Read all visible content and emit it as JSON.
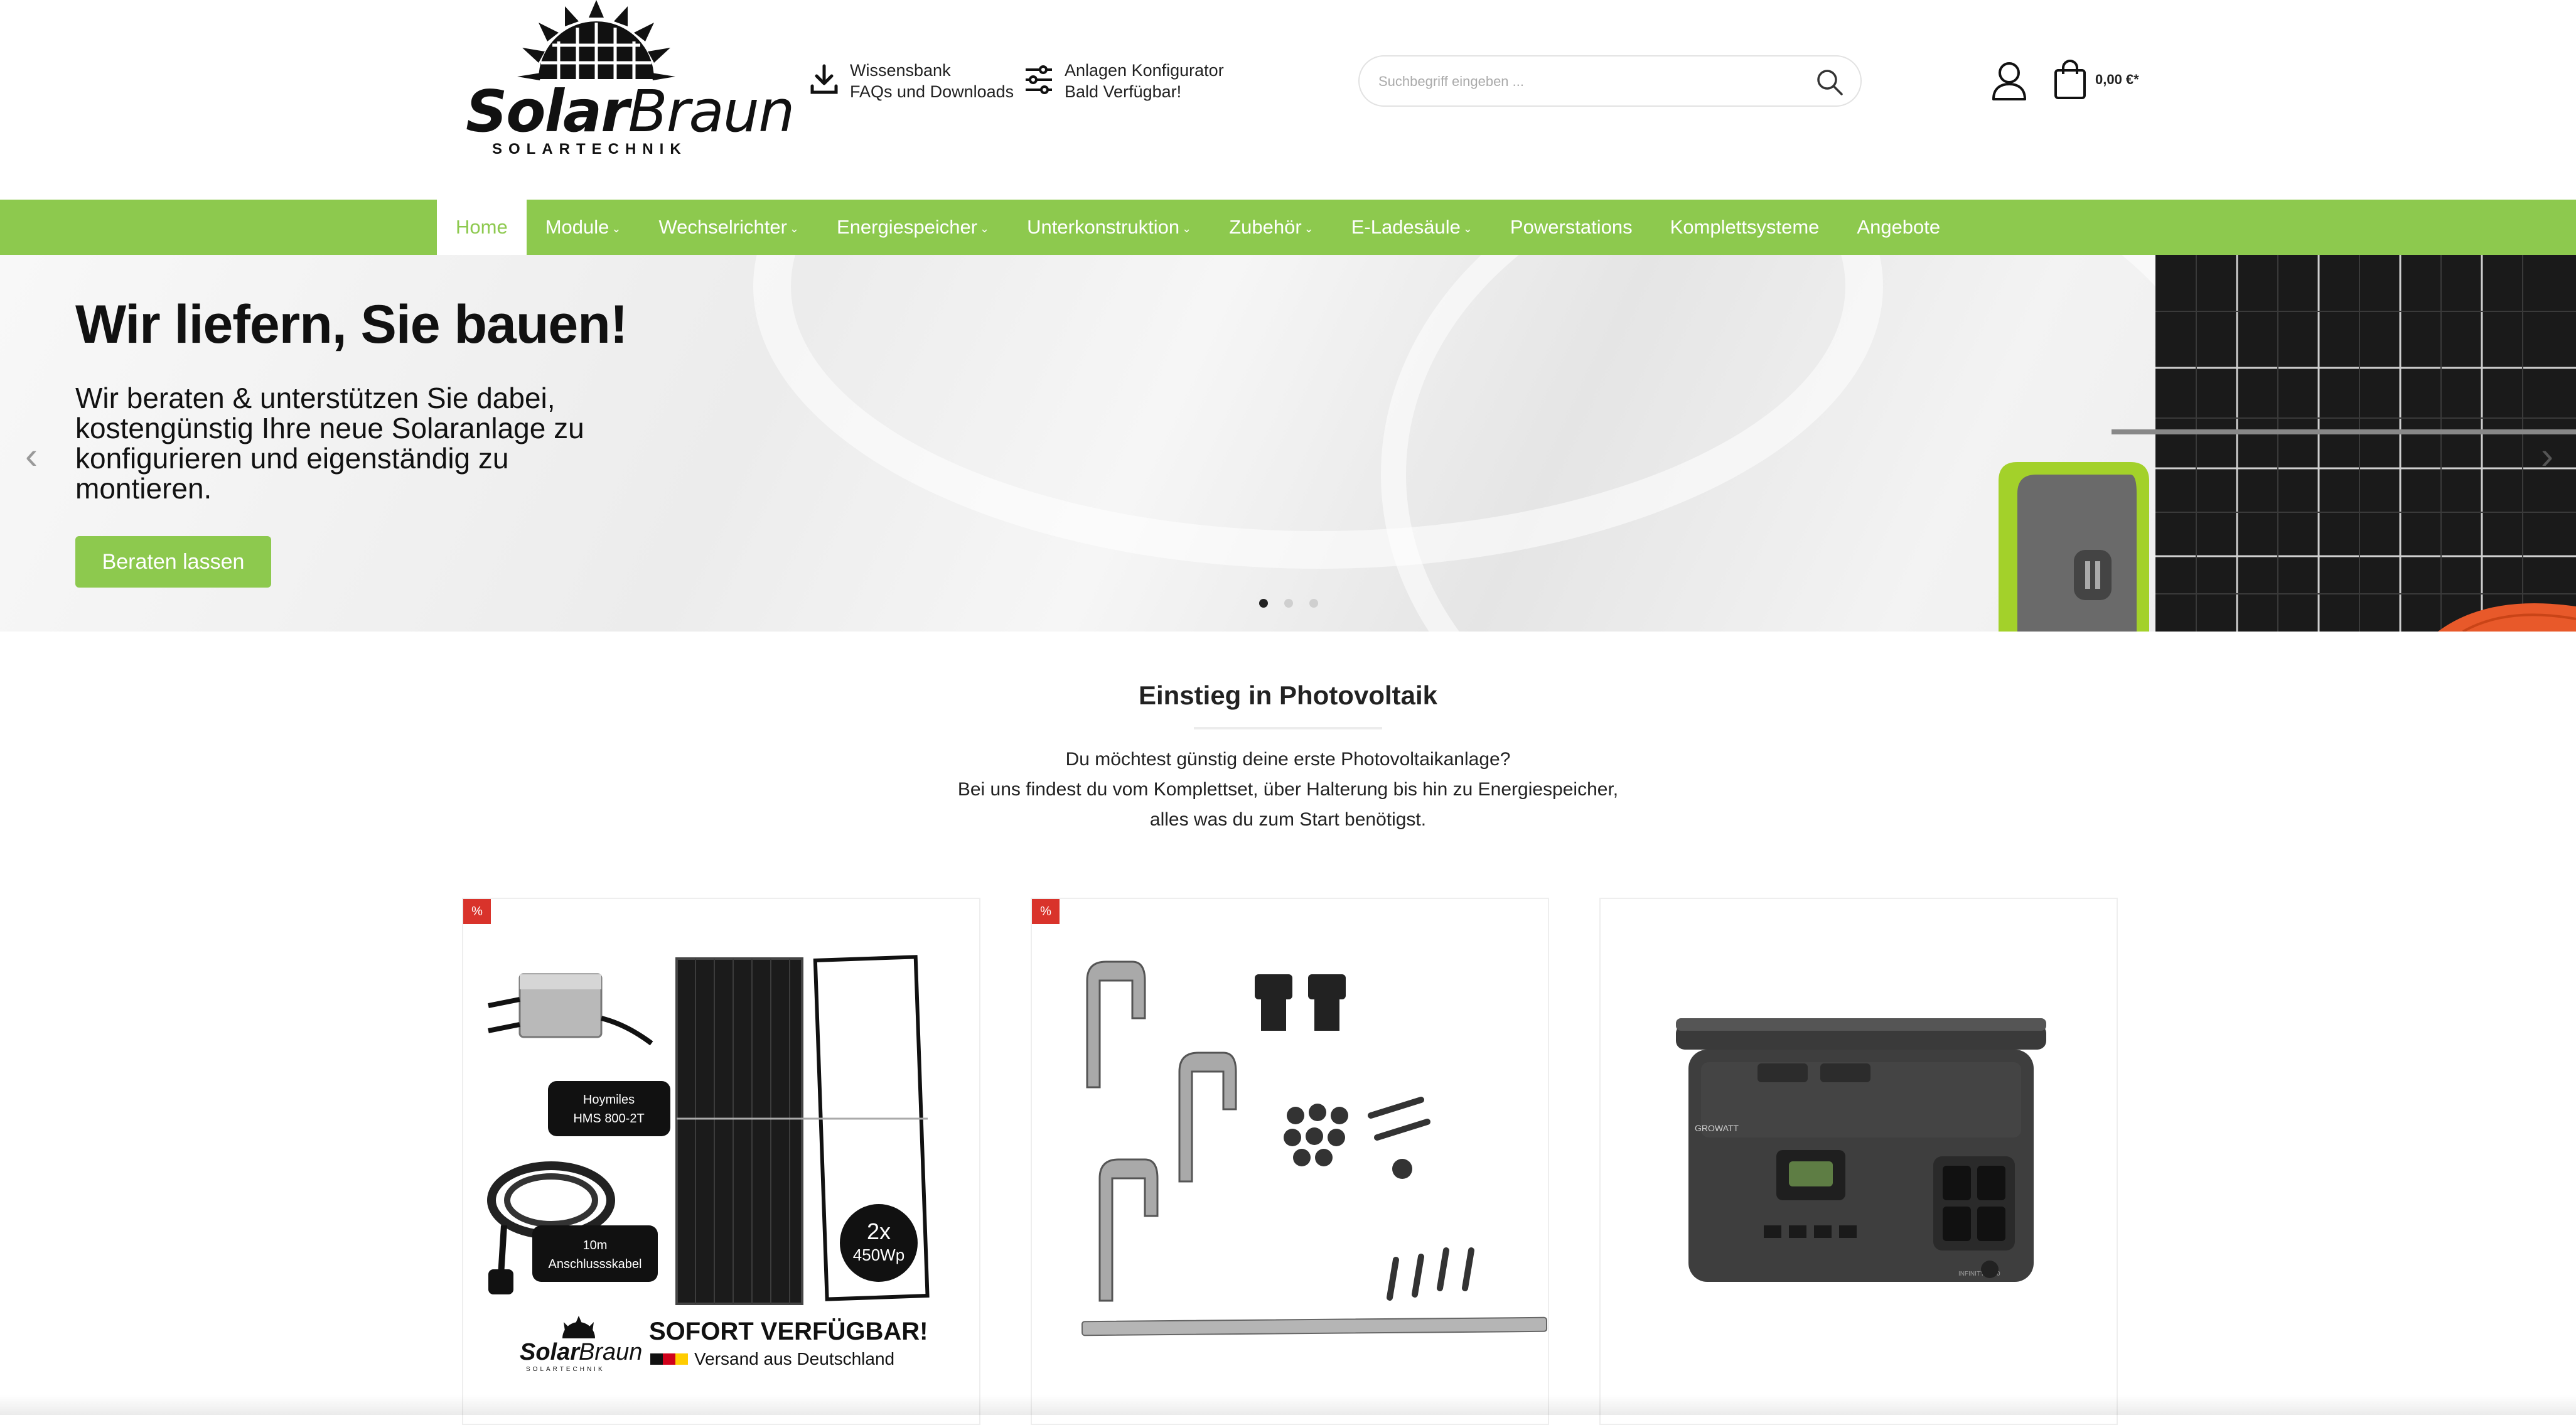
{
  "brand": {
    "name_bold": "Solar",
    "name_thin": "Braun",
    "tagline": "SOLARTECHNIK"
  },
  "header": {
    "links": [
      {
        "line1": "Wissensbank",
        "line2": "FAQs und Downloads",
        "icon": "download-icon"
      },
      {
        "line1": "Anlagen Konfigurator",
        "line2": "Bald Verfügbar!",
        "icon": "sliders-icon"
      }
    ],
    "search_placeholder": "Suchbegriff eingeben ...",
    "cart_amount": "0,00 €*"
  },
  "nav": {
    "items": [
      {
        "label": "Home",
        "has_dropdown": false,
        "active": true
      },
      {
        "label": "Module",
        "has_dropdown": true
      },
      {
        "label": "Wechselrichter",
        "has_dropdown": true
      },
      {
        "label": "Energiespeicher",
        "has_dropdown": true
      },
      {
        "label": "Unterkonstruktion",
        "has_dropdown": true
      },
      {
        "label": "Zubehör",
        "has_dropdown": true
      },
      {
        "label": "E-Ladesäule",
        "has_dropdown": true
      },
      {
        "label": "Powerstations",
        "has_dropdown": false
      },
      {
        "label": "Komplettsysteme",
        "has_dropdown": false
      },
      {
        "label": "Angebote",
        "has_dropdown": false
      }
    ],
    "chevron": "⌄"
  },
  "hero": {
    "title": "Wir liefern, Sie bauen!",
    "text": "Wir beraten & unterstützen Sie dabei, kostengünstig Ihre neue Solaranlage zu konfigurieren und eigenständig zu montieren.",
    "button": "Beraten lassen",
    "slides": 3,
    "active_slide": 1
  },
  "intro": {
    "title": "Einstieg in Photovoltaik",
    "lines": [
      "Du möchtest günstig deine erste Photovoltaikanlage?",
      "Bei uns findest du vom Komplettset, über Halterung bis hin zu Energiespeicher,",
      "alles was du zum Start benötigst."
    ]
  },
  "products": [
    {
      "badge": "%",
      "inverter_label": [
        "Hoymiles",
        "HMS 800-2T"
      ],
      "cable_label": [
        "10m",
        "Anschlussskabel"
      ],
      "count_label": [
        "2x",
        "450Wp"
      ],
      "logo_bold": "Solar",
      "logo_thin": "Braun",
      "logo_sub": "SOLARTECHNIK",
      "promo_title": "SOFORT VERFÜGBAR!",
      "promo_sub": "Versand aus Deutschland"
    },
    {
      "badge": "%"
    },
    {
      "badge": "",
      "device_brand": "GROWATT",
      "device_model": "INFINITY 1500"
    }
  ],
  "colors": {
    "accent": "#8dc94e",
    "badge": "#d9332b"
  }
}
